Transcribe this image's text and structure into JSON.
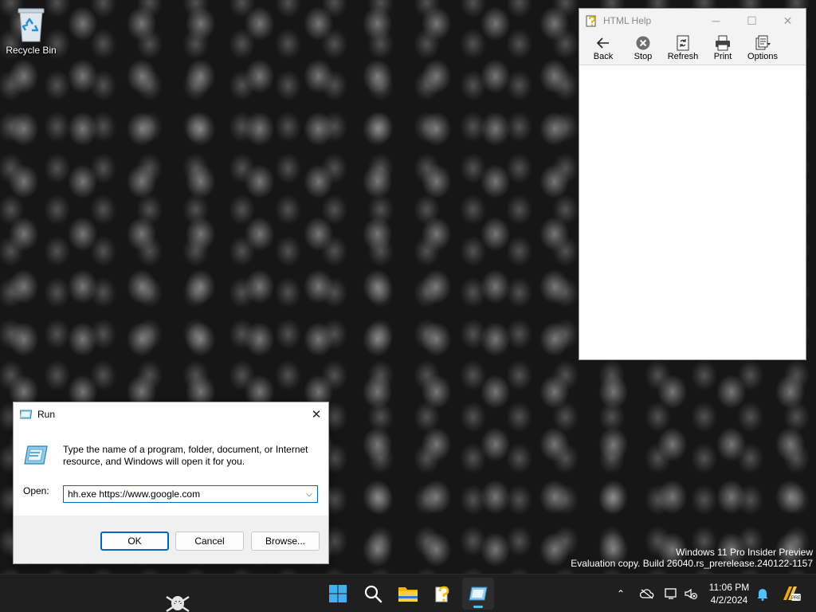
{
  "desktop": {
    "recycle_bin_label": "Recycle Bin",
    "watermark_line1": "Windows 11 Pro Insider Preview",
    "watermark_line2": "Evaluation copy. Build 26040.rs_prerelease.240122-1157"
  },
  "help_window": {
    "title": "HTML Help",
    "toolbar": {
      "back": "Back",
      "stop": "Stop",
      "refresh": "Refresh",
      "print": "Print",
      "options": "Options"
    }
  },
  "run_dialog": {
    "title": "Run",
    "description": "Type the name of a program, folder, document, or Internet resource, and Windows will open it for you.",
    "open_label": "Open:",
    "open_value": "hh.exe https://www.google.com",
    "ok_label": "OK",
    "cancel_label": "Cancel",
    "browse_label": "Browse..."
  },
  "taskbar": {
    "time": "11:06 PM",
    "date": "4/2/2024",
    "accent": "#4cc2ff"
  }
}
